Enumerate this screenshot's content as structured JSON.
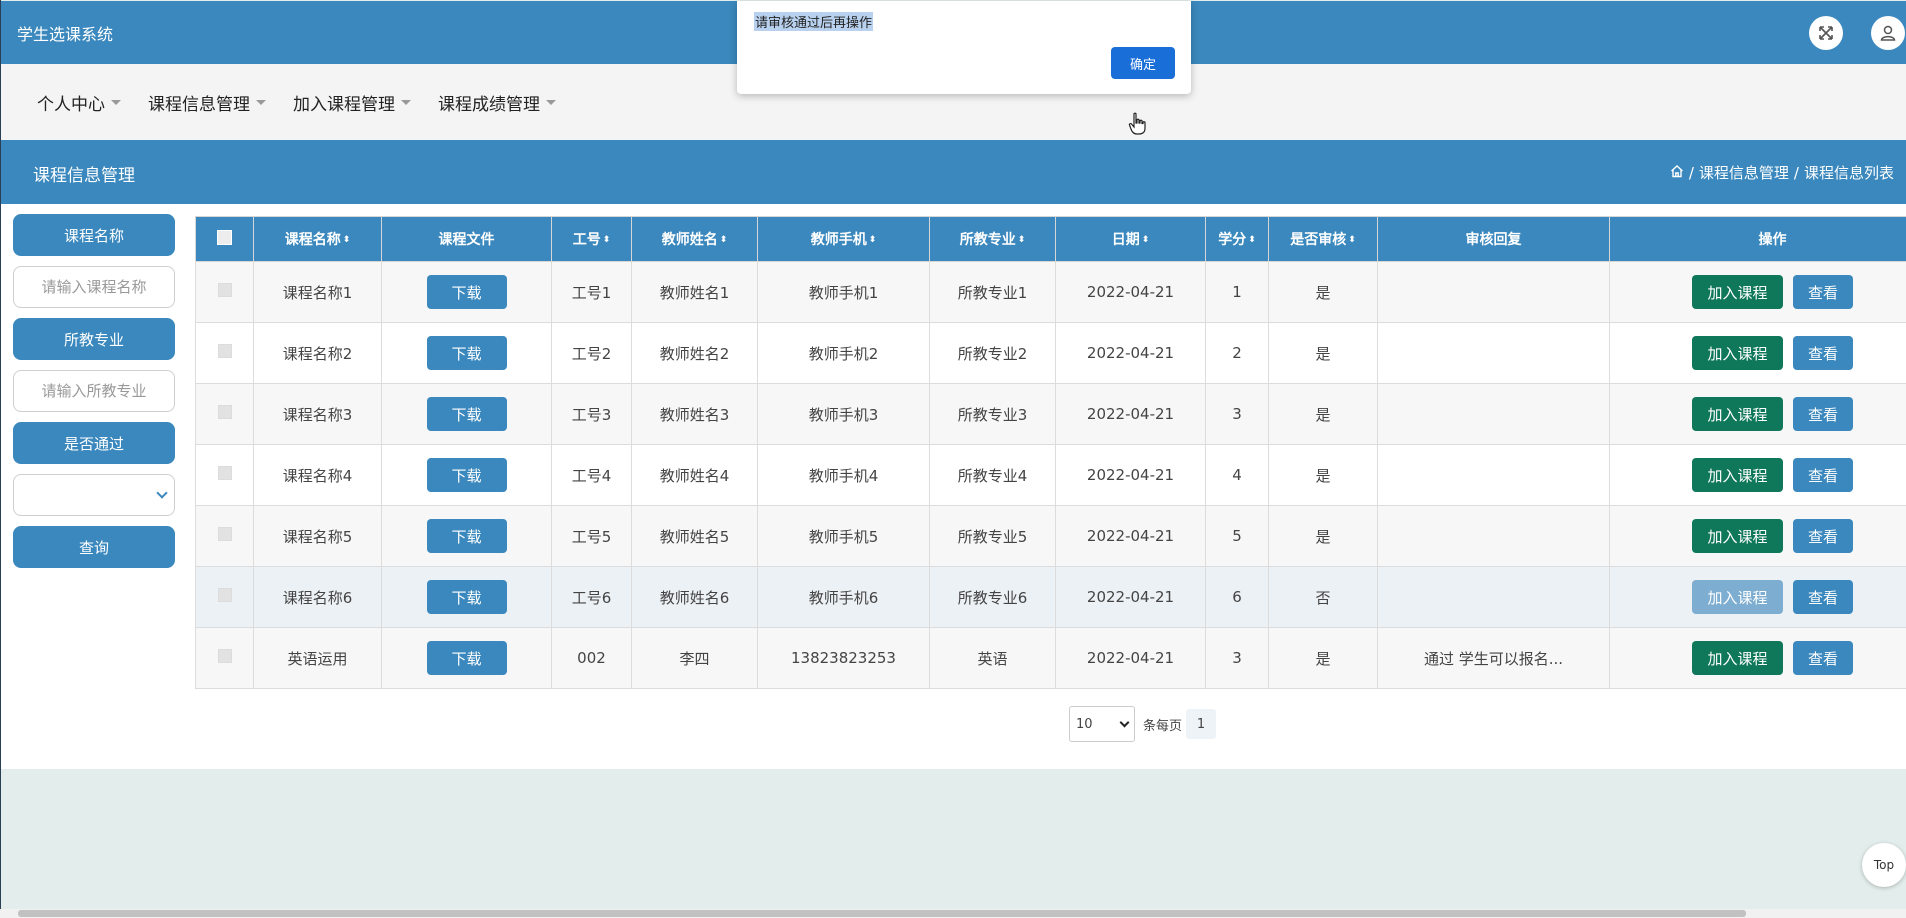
{
  "app": {
    "title": "学生选课系统"
  },
  "nav": [
    {
      "label": "个人中心"
    },
    {
      "label": "课程信息管理"
    },
    {
      "label": "加入课程管理"
    },
    {
      "label": "课程成绩管理"
    }
  ],
  "subheader": {
    "title": "课程信息管理",
    "breadcrumb": [
      "课程信息管理",
      "课程信息列表"
    ],
    "separator": "/"
  },
  "sidebar": {
    "course_label": "课程名称",
    "course_placeholder": "请输入课程名称",
    "major_label": "所教专业",
    "major_placeholder": "请输入所教专业",
    "approved_label": "是否通过",
    "approved_value": "",
    "search_button": "查询"
  },
  "table": {
    "columns": [
      "课程名称",
      "课程文件",
      "工号",
      "教师姓名",
      "教师手机",
      "所教专业",
      "日期",
      "学分",
      "是否审核",
      "审核回复",
      "操作"
    ],
    "download_label": "下载",
    "join_label": "加入课程",
    "view_label": "查看",
    "rows": [
      {
        "course": "课程名称1",
        "job_no": "工号1",
        "teacher": "教师姓名1",
        "phone": "教师手机1",
        "major": "所教专业1",
        "date": "2022-04-21",
        "credit": "1",
        "approved": "是",
        "reply": "",
        "join_enabled": true
      },
      {
        "course": "课程名称2",
        "job_no": "工号2",
        "teacher": "教师姓名2",
        "phone": "教师手机2",
        "major": "所教专业2",
        "date": "2022-04-21",
        "credit": "2",
        "approved": "是",
        "reply": "",
        "join_enabled": true
      },
      {
        "course": "课程名称3",
        "job_no": "工号3",
        "teacher": "教师姓名3",
        "phone": "教师手机3",
        "major": "所教专业3",
        "date": "2022-04-21",
        "credit": "3",
        "approved": "是",
        "reply": "",
        "join_enabled": true
      },
      {
        "course": "课程名称4",
        "job_no": "工号4",
        "teacher": "教师姓名4",
        "phone": "教师手机4",
        "major": "所教专业4",
        "date": "2022-04-21",
        "credit": "4",
        "approved": "是",
        "reply": "",
        "join_enabled": true
      },
      {
        "course": "课程名称5",
        "job_no": "工号5",
        "teacher": "教师姓名5",
        "phone": "教师手机5",
        "major": "所教专业5",
        "date": "2022-04-21",
        "credit": "5",
        "approved": "是",
        "reply": "",
        "join_enabled": true
      },
      {
        "course": "课程名称6",
        "job_no": "工号6",
        "teacher": "教师姓名6",
        "phone": "教师手机6",
        "major": "所教专业6",
        "date": "2022-04-21",
        "credit": "6",
        "approved": "否",
        "reply": "",
        "join_enabled": false
      },
      {
        "course": "英语运用",
        "job_no": "002",
        "teacher": "李四",
        "phone": "13823823253",
        "major": "英语",
        "date": "2022-04-21",
        "credit": "3",
        "approved": "是",
        "reply": "通过 学生可以报名...",
        "join_enabled": true
      }
    ]
  },
  "pagination": {
    "page_size": "10",
    "per_page_label": "条每页",
    "current_page": "1"
  },
  "alert": {
    "message": "请审核通过后再操作",
    "ok_label": "确定"
  },
  "back_to_top": "Top",
  "colors": {
    "primary": "#3a88bd",
    "join": "#10785a",
    "join_disabled": "#7dadd0",
    "ok": "#1a6ed8"
  }
}
